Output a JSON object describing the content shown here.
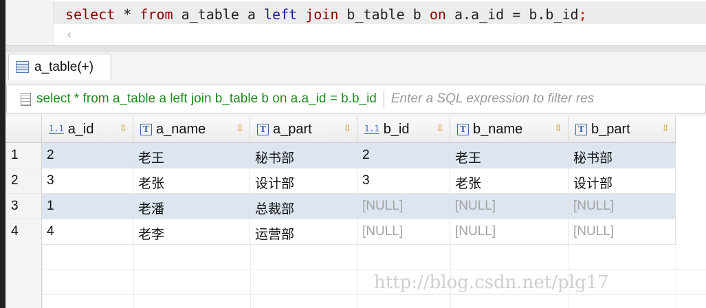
{
  "editor": {
    "query_parts": [
      "select",
      " * ",
      "from",
      " a_table a ",
      "left",
      " ",
      "join",
      " b_table b ",
      "on",
      " a.a_id = b.b_id",
      ";"
    ],
    "scroll_left_icon": "chevron-left-icon"
  },
  "result_tab": {
    "label": "a_table(+)",
    "icon": "table-icon"
  },
  "filter": {
    "query": "select * from a_table a left join b_table b on a.a_id = b.b_id",
    "placeholder": "Enter a SQL expression to filter res"
  },
  "columns": [
    {
      "name": "a_id",
      "type_icon": "numeric-column-icon"
    },
    {
      "name": "a_name",
      "type_icon": "text-column-icon"
    },
    {
      "name": "a_part",
      "type_icon": "text-column-icon"
    },
    {
      "name": "b_id",
      "type_icon": "numeric-column-icon"
    },
    {
      "name": "b_name",
      "type_icon": "text-column-icon"
    },
    {
      "name": "b_part",
      "type_icon": "text-column-icon"
    }
  ],
  "rows": [
    {
      "num": "1",
      "cells": [
        "2",
        "老王",
        "秘书部",
        "2",
        "老王",
        "秘书部"
      ]
    },
    {
      "num": "2",
      "cells": [
        "3",
        "老张",
        "设计部",
        "3",
        "老张",
        "设计部"
      ]
    },
    {
      "num": "3",
      "cells": [
        "1",
        "老潘",
        "总裁部",
        "[NULL]",
        "[NULL]",
        "[NULL]"
      ]
    },
    {
      "num": "4",
      "cells": [
        "4",
        "老李",
        "运营部",
        "[NULL]",
        "[NULL]",
        "[NULL]"
      ]
    }
  ],
  "watermark": "http://blog.csdn.net/plg17",
  "colors": {
    "null_text": "#a3a3a3",
    "alt_row": "#dde5f0",
    "keyword": "#8b0000",
    "filter_sql": "#1c8a1c"
  }
}
